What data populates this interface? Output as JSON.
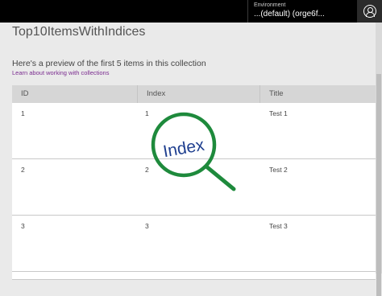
{
  "topbar": {
    "environment_label": "Environment",
    "environment_value": "...(default) (orge6f...",
    "profile_icon": "person-icon"
  },
  "page": {
    "title": "Top10ItemsWithIndices",
    "preview_text": "Here's a preview of the first 5 items in this collection",
    "learn_link": "Learn about working with collections"
  },
  "table": {
    "headers": [
      "ID",
      "Index",
      "Title"
    ],
    "rows": [
      {
        "id": "1",
        "index": "1",
        "title": "Test 1"
      },
      {
        "id": "2",
        "index": "2",
        "title": "Test 2"
      },
      {
        "id": "3",
        "index": "3",
        "title": "Test 3"
      }
    ]
  },
  "annotation": {
    "magnifier_label": "Index",
    "color": "#1e8a3c",
    "icon": "magnifier-icon"
  },
  "colors": {
    "topbar": "#000000",
    "link": "#7a2b8f",
    "header": "#d6d6d6"
  }
}
